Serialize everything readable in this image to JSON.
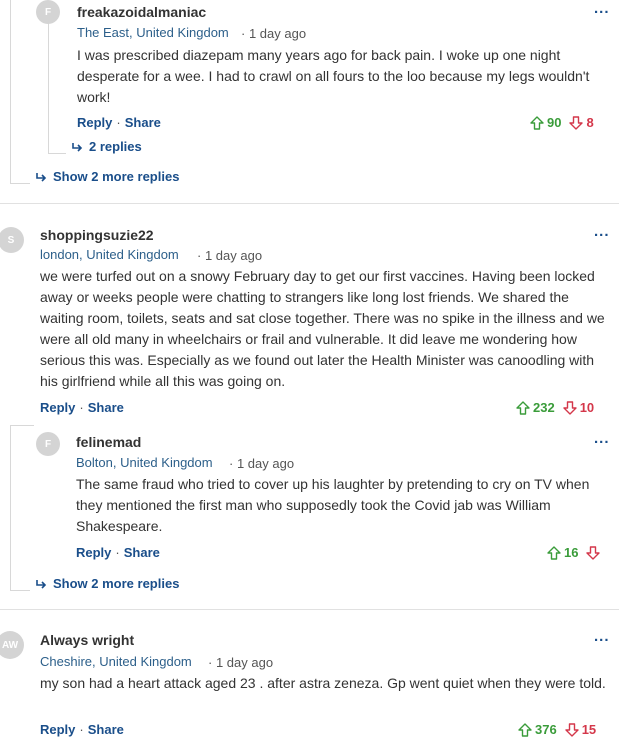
{
  "colors": {
    "link": "#1a4e8a",
    "location": "#2c5f8a",
    "upvote": "#3a9c3a",
    "downvote": "#d4374a"
  },
  "icons": {
    "up": "arrow-up-icon",
    "down": "arrow-down-icon",
    "reply_arrow": "reply-arrow-icon",
    "more": "more-options-icon"
  },
  "labels": {
    "reply": "Reply",
    "share": "Share",
    "more": "..."
  },
  "comments": [
    {
      "avatar": "F",
      "username": "freakazoidalmaniac",
      "location": "The East, United Kingdom",
      "time": "· 1 day ago",
      "body": "I was prescribed diazepam many years ago for back pain. I woke up one night desperate for a wee. I had to crawl on all fours to the loo because my legs wouldn't work!",
      "up": "90",
      "down": "8",
      "replies": "2 replies"
    },
    {
      "show_more": "Show 2 more replies"
    },
    {
      "avatar": "S",
      "username": "shoppingsuzie22",
      "location": "london, United Kingdom",
      "time": "· 1 day ago",
      "body": "we were turfed out on a snowy February day to get our first vaccines.   Having been locked away or weeks people were chatting to strangers like long lost friends.  We shared the waiting room, toilets, seats and sat close together.   There was no spike in the illness and we were all old  many in wheelchairs or frail  and vulnerable.   It did leave me wondering how serious this was. Especially as we found out later the Health Minister was canoodling with his girlfriend while all this was going on.",
      "up": "232",
      "down": "10"
    },
    {
      "avatar": "F",
      "username": "felinemad",
      "location": "Bolton, United Kingdom",
      "time": "· 1 day ago",
      "body": "The same fraud who tried to cover up his laughter by pretending to cry on TV when they mentioned the first man who supposedly took the Covid jab was William Shakespeare.",
      "up": "16",
      "down": "",
      "show_more": "Show 2 more replies"
    },
    {
      "avatar": "AW",
      "username": "Always wright",
      "location": "Cheshire, United Kingdom",
      "time": "· 1 day ago",
      "body": "my son had a heart attack aged 23 . after astra zeneza. Gp went quiet when they were told.",
      "up": "376",
      "down": "15"
    }
  ]
}
